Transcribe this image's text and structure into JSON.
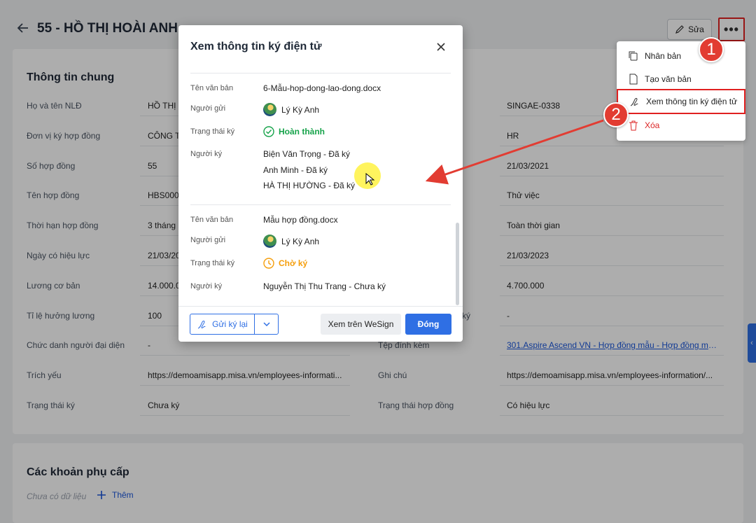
{
  "header": {
    "title": "55 - HỒ THỊ HOÀI ANH",
    "edit_label": "Sửa",
    "more_label": "•••"
  },
  "general": {
    "title": "Thông tin chung",
    "left_rows": [
      {
        "label": "Họ và tên NLĐ",
        "value": "HỒ THỊ H"
      },
      {
        "label": "Đơn vị ký hợp đồng",
        "value": "CÔNG TY"
      },
      {
        "label": "Số hợp đồng",
        "value": "55"
      },
      {
        "label": "Tên hợp đồng",
        "value": "HBS000"
      },
      {
        "label": "Thời hạn hợp đồng",
        "value": "3 tháng"
      },
      {
        "label": "Ngày có hiệu lực",
        "value": "21/03/20"
      },
      {
        "label": "Lương cơ bản",
        "value": "14.000.0"
      },
      {
        "label": "Tỉ lệ hưởng lương",
        "value": "100"
      },
      {
        "label": "Chức danh người đại diện",
        "value": "-"
      },
      {
        "label": "Trích yếu",
        "value": "https://demoamisapp.misa.vn/employees-informati..."
      },
      {
        "label": "Trạng thái ký",
        "value": "Chưa ký"
      }
    ],
    "right_rows": [
      {
        "label": "",
        "value": "SINGAE-0338"
      },
      {
        "label": "",
        "value": "HR"
      },
      {
        "label": "",
        "value": "21/03/2021"
      },
      {
        "label": "",
        "value": "Thử việc"
      },
      {
        "label": "",
        "value": "Toàn thời gian"
      },
      {
        "label": "",
        "value": "21/03/2023"
      },
      {
        "label": "",
        "value": "4.700.000"
      },
      {
        "label": "ký",
        "value": "-"
      },
      {
        "label": "Tệp đính kèm",
        "value": "301.Aspire Ascend VN - Hợp đồng mẫu - Hợp đồng mẫu..."
      },
      {
        "label": "Ghi chú",
        "value": "https://demoamisapp.misa.vn/employees-information/..."
      },
      {
        "label": "Trạng thái hợp đồng",
        "value": "Có hiệu lực"
      }
    ]
  },
  "allowance": {
    "title": "Các khoản phụ cấp",
    "empty": "Chưa có dữ liệu",
    "add_label": "Thêm"
  },
  "menu": {
    "items": [
      {
        "label": "Nhân bản",
        "icon": "copy-icon"
      },
      {
        "label": "Tạo văn bản",
        "icon": "document-icon"
      },
      {
        "label": "Xem thông tin ký điện tử",
        "icon": "signature-icon"
      },
      {
        "label": "Xóa",
        "icon": "trash-icon"
      }
    ]
  },
  "badges": {
    "one": "1",
    "two": "2"
  },
  "modal": {
    "title": "Xem thông tin ký điện tử",
    "doc1": {
      "name_label": "Tên văn bản",
      "name": "6-Mẫu-hop-dong-lao-dong.docx",
      "sender_label": "Người gửi",
      "sender": "Lý Kỳ Anh",
      "status_label": "Trạng thái ký",
      "status": "Hoàn thành",
      "signer_label": "Người ký",
      "signers": [
        "Biện Văn Trọng - Đã ký",
        "Anh Minh - Đã ký",
        "HÀ THỊ HƯỜNG - Đã ký"
      ]
    },
    "doc2": {
      "name_label": "Tên văn bản",
      "name": "Mẫu hợp đồng.docx",
      "sender_label": "Người gửi",
      "sender": "Lý Kỳ Anh",
      "status_label": "Trạng thái ký",
      "status": "Chờ ký",
      "signer_label": "Người ký",
      "signers": [
        "Nguyễn Thị Thu Trang - Chưa ký"
      ]
    },
    "resend_label": "Gửi ký lại",
    "wesign_label": "Xem trên WeSign",
    "close_label": "Đóng"
  },
  "colors": {
    "accent": "#2f6fe4",
    "success": "#16a34a",
    "warning": "#f59e0b",
    "danger": "#e02020"
  }
}
